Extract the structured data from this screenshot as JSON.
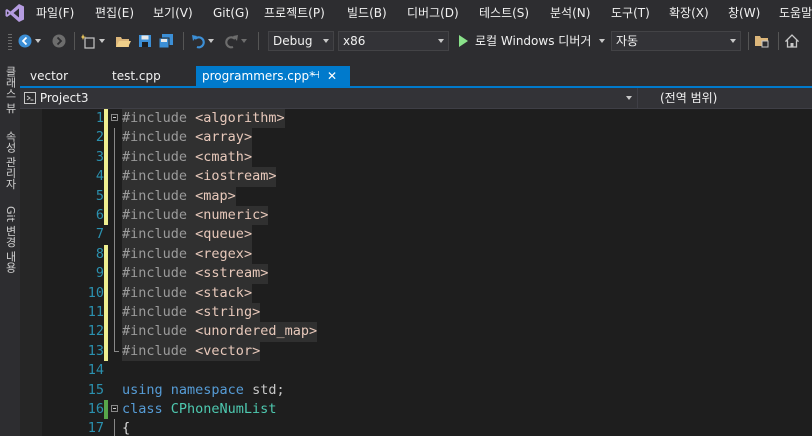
{
  "menubar": {
    "items": [
      "파일(F)",
      "편집(E)",
      "보기(V)",
      "Git(G)",
      "프로젝트(P)",
      "빌드(B)",
      "디버그(D)",
      "테스트(S)",
      "분석(N)",
      "도구(T)",
      "확장(X)",
      "창(W)",
      "도움말"
    ]
  },
  "toolbar": {
    "configuration": "Debug",
    "platform": "x86",
    "run_label": "로컬 Windows 디버거",
    "run_mode": "자동"
  },
  "side_tabs": [
    "클래스 뷰",
    "속성 관리자",
    "Git 변경 내용"
  ],
  "tabs": [
    {
      "label": "vector"
    },
    {
      "label": "test.cpp"
    },
    {
      "label": "programmers.cpp*",
      "pin": "⊣",
      "close": "✕"
    }
  ],
  "navbar": {
    "project": "Project3",
    "scope": "(전역 범위)"
  },
  "code_lines": [
    {
      "num": "1",
      "directive": "#include",
      "header": "<algorithm>"
    },
    {
      "num": "2",
      "directive": "#include",
      "header": "<array>"
    },
    {
      "num": "3",
      "directive": "#include",
      "header": "<cmath>"
    },
    {
      "num": "4",
      "directive": "#include",
      "header": "<iostream>"
    },
    {
      "num": "5",
      "directive": "#include",
      "header": "<map>"
    },
    {
      "num": "6",
      "directive": "#include",
      "header": "<numeric>"
    },
    {
      "num": "7",
      "directive": "#include",
      "header": "<queue>"
    },
    {
      "num": "8",
      "directive": "#include",
      "header": "<regex>"
    },
    {
      "num": "9",
      "directive": "#include",
      "header": "<sstream>"
    },
    {
      "num": "10",
      "directive": "#include",
      "header": "<stack>"
    },
    {
      "num": "11",
      "directive": "#include",
      "header": "<string>"
    },
    {
      "num": "12",
      "directive": "#include",
      "header": "<unordered_map>"
    },
    {
      "num": "13",
      "directive": "#include",
      "header": "<vector>"
    },
    {
      "num": "14"
    },
    {
      "num": "15",
      "kw1": "using",
      "kw2": "namespace",
      "ident": "std;"
    },
    {
      "num": "16",
      "kw1": "class",
      "type": "CPhoneNumList"
    },
    {
      "num": "17",
      "text": "{"
    }
  ],
  "colors": {
    "accent": "#007acc",
    "line_number": "#2b91af",
    "keyword": "#569cd6",
    "string": "#e8c9bb",
    "type": "#4ec9b0",
    "change_unsaved": "#efef90",
    "change_saved": "#57a64a"
  },
  "icons": [
    "visual-studio-logo",
    "back-icon",
    "forward-icon",
    "new-project-icon",
    "open-folder-icon",
    "save-icon",
    "save-all-icon",
    "undo-icon",
    "redo-icon",
    "play-icon",
    "folder-view-icon",
    "home-icon"
  ]
}
